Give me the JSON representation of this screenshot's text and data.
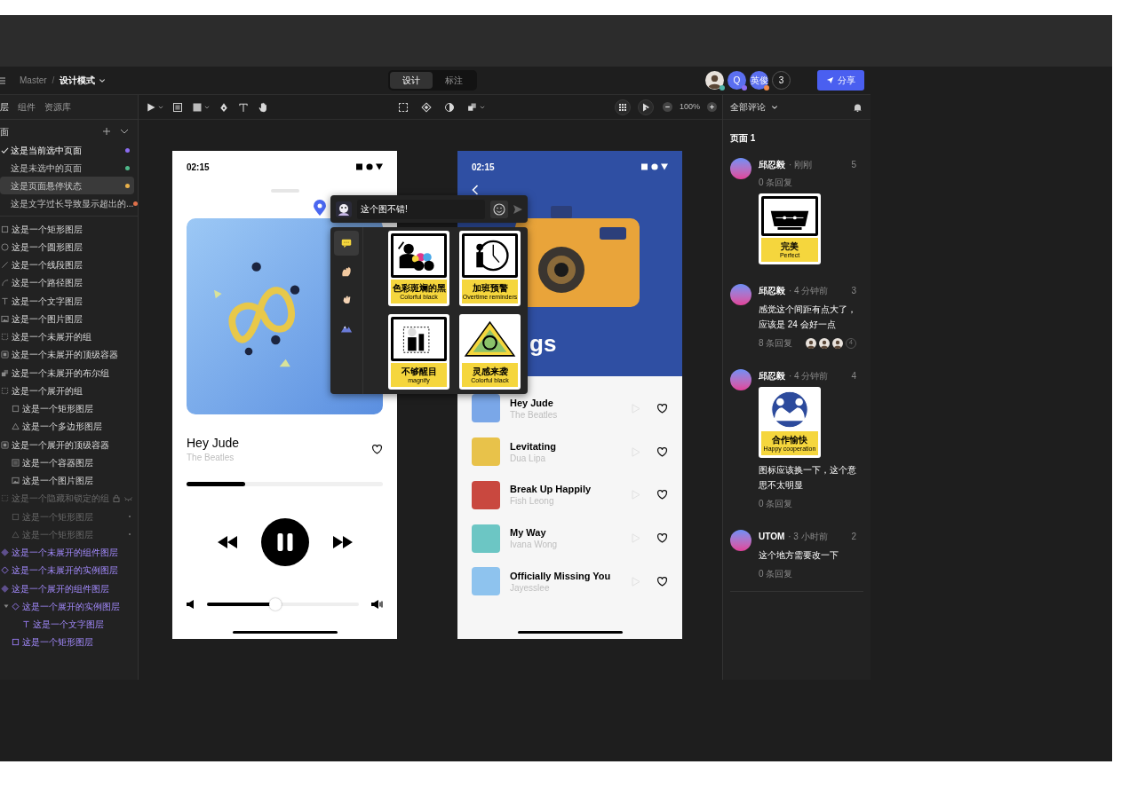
{
  "breadcrumb": {
    "project": "Master",
    "separator": "/",
    "mode": "设计模式"
  },
  "mode_tabs": [
    {
      "label": "设计",
      "selected": true
    },
    {
      "label": "标注",
      "selected": false
    }
  ],
  "collaborators": [
    {
      "kind": "photo",
      "color": "#4fb3a8"
    },
    {
      "kind": "initial",
      "label": "Q",
      "color": "#8b6cf0"
    },
    {
      "kind": "initial",
      "label": "英俊",
      "color": "#f08a4b"
    },
    {
      "kind": "count",
      "label": "3"
    }
  ],
  "share_button": "分享",
  "zoom": "100%",
  "left_panel": {
    "tabs": [
      {
        "label": "层",
        "selected": true
      },
      {
        "label": "组件",
        "selected": false
      },
      {
        "label": "资源库",
        "selected": false
      }
    ],
    "pages_heading": "面",
    "pages": [
      {
        "label": "这是当前选中页面",
        "selected": true,
        "hovered": false,
        "color": "#8b6cf0"
      },
      {
        "label": "这是未选中的页面",
        "selected": false,
        "hovered": false,
        "color": "#4fb88a"
      },
      {
        "label": "这是页面悬停状态",
        "selected": false,
        "hovered": true,
        "color": "#e8b04a"
      },
      {
        "label": "这是文字过长导致显示超出的...",
        "selected": false,
        "hovered": false,
        "color": "#e0704a"
      }
    ],
    "layers": [
      {
        "kind": "rect",
        "label": "这是一个矩形图层"
      },
      {
        "kind": "ellipse",
        "label": "这是一个圆形图层"
      },
      {
        "kind": "line",
        "label": "这是一个线段图层"
      },
      {
        "kind": "path",
        "label": "这是一个路径图层"
      },
      {
        "kind": "text",
        "label": "这是一个文字图层"
      },
      {
        "kind": "image",
        "label": "这是一个图片图层"
      },
      {
        "kind": "group",
        "label": "这是一个未展开的组"
      },
      {
        "kind": "frame",
        "label": "这是一个未展开的顶级容器"
      },
      {
        "kind": "boolean",
        "label": "这是一个未展开的布尔组"
      },
      {
        "kind": "group",
        "label": "这是一个展开的组",
        "children": [
          {
            "kind": "rect",
            "label": "这是一个矩形图层"
          },
          {
            "kind": "polygon",
            "label": "这是一个多边形图层"
          }
        ]
      },
      {
        "kind": "frame",
        "label": "这是一个展开的顶级容器",
        "children": [
          {
            "kind": "container",
            "label": "这是一个容器图层"
          },
          {
            "kind": "image",
            "label": "这是一个图片图层"
          }
        ]
      },
      {
        "kind": "group",
        "label": "这是一个隐藏和锁定的组",
        "hidden": true,
        "locked": true,
        "children": [
          {
            "kind": "rect",
            "label": "这是一个矩形图层",
            "hidden": true
          },
          {
            "kind": "polygon",
            "label": "这是一个矩形图层",
            "hidden": true
          }
        ]
      },
      {
        "kind": "component",
        "label": "这是一个未展开的组件图层"
      },
      {
        "kind": "instance",
        "label": "这是一个未展开的实例图层"
      },
      {
        "kind": "component",
        "label": "这是一个展开的组件图层",
        "children": [
          {
            "kind": "instance",
            "label": "这是一个展开的实例图层",
            "expanded": true,
            "children": [
              {
                "kind": "text",
                "label": "这是一个文字图层"
              }
            ]
          },
          {
            "kind": "rect",
            "label": "这是一个矩形图层"
          }
        ]
      }
    ]
  },
  "player_screen": {
    "time": "02:15",
    "song_title": "Hey Jude",
    "artist": "The Beatles",
    "progress": {
      "level": 0.3
    },
    "volume": {
      "level": 0.45
    }
  },
  "playlist_screen": {
    "time": "02:15",
    "heading_fragment": "gs",
    "songs": [
      {
        "title": "Hey Jude",
        "artist": "The Beatles",
        "color": "#7aa7e8"
      },
      {
        "title": "Levitating",
        "artist": "Dua Lipa",
        "color": "#e8c24a"
      },
      {
        "title": "Break Up Happily",
        "artist": "Fish Leong",
        "color": "#c9483f"
      },
      {
        "title": "My Way",
        "artist": "Ivana Wong",
        "color": "#6cc6c4"
      },
      {
        "title": "Officially Missing You",
        "artist": "Jayesslee",
        "color": "#8ec3ee"
      }
    ]
  },
  "comment_popup": {
    "input_value": "这个图不错!",
    "sticker_tabs": [
      {
        "kind": "chat",
        "selected": true
      },
      {
        "kind": "clap",
        "selected": false
      },
      {
        "kind": "hand",
        "selected": false
      },
      {
        "kind": "mountain",
        "selected": false
      }
    ],
    "stickers": [
      {
        "kind": "colorful",
        "title": "色彩斑斓的黑",
        "subtitle": "Colorful black"
      },
      {
        "kind": "clock",
        "title": "加班预警",
        "subtitle": "Overtime reminders"
      },
      {
        "kind": "magnify",
        "title": "不够醒目",
        "subtitle": "magnify"
      },
      {
        "kind": "sixty",
        "title": "灵感来袭",
        "subtitle": "Colorful black"
      }
    ]
  },
  "comments_panel": {
    "filter": "全部评论",
    "page_heading": "页面 1",
    "comments": [
      {
        "author": "邱忍毅",
        "time": "· 刚刚",
        "number": "5",
        "blocks": [
          {
            "kind": "replies",
            "label": "0 条回复"
          },
          {
            "kind": "sticker",
            "sticker": {
              "kind": "perfect",
              "title": "完美",
              "subtitle": "Perfect"
            }
          }
        ]
      },
      {
        "author": "邱忍毅",
        "time": "· 4 分钟前",
        "number": "3",
        "blocks": [
          {
            "kind": "text",
            "text": "感觉这个间距有点大了，应该是 24 会好一点"
          },
          {
            "kind": "replies",
            "label": "8 条回复",
            "avatars": [
              {
                "kind": "photo"
              },
              {
                "kind": "photo"
              },
              {
                "kind": "photo"
              }
            ],
            "more": "4"
          }
        ]
      },
      {
        "author": "邱忍毅",
        "time": "· 4 分钟前",
        "number": "4",
        "blocks": [
          {
            "kind": "sticker",
            "sticker": {
              "kind": "cooperation",
              "title": "合作愉快",
              "subtitle": "Happy cooperation"
            }
          },
          {
            "kind": "text",
            "text": "图标应该换一下，这个意思不太明显"
          },
          {
            "kind": "replies",
            "label": "0 条回复"
          }
        ]
      },
      {
        "author": "UTOM",
        "time": "· 3 小时前",
        "number": "2",
        "blocks": [
          {
            "kind": "text",
            "text": "这个地方需要改一下"
          },
          {
            "kind": "replies",
            "label": "0 条回复"
          }
        ]
      }
    ]
  }
}
